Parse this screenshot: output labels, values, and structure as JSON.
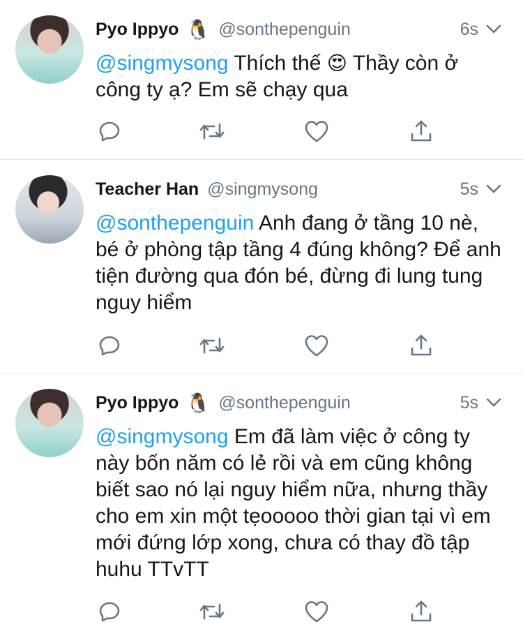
{
  "tweets": [
    {
      "display_name": "Pyo Ippyo",
      "badge_emoji": "🐧",
      "handle": "@sonthepenguin",
      "time": "6s",
      "mention": "@singmysong",
      "text_before_emoji": " Thích thế ",
      "emoji": "😍",
      "text_after_emoji": " Thầy còn ở công ty ạ? Em sẽ chạy qua"
    },
    {
      "display_name": "Teacher Han",
      "handle": "@singmysong",
      "time": "5s",
      "mention": "@sonthepenguin",
      "text": " Anh đang ở tầng 10 nè, bé ở phòng tập tầng 4 đúng không? Để anh tiện đường qua đón bé, đừng đi lung tung nguy hiểm"
    },
    {
      "display_name": "Pyo Ippyo",
      "badge_emoji": "🐧",
      "handle": "@sonthepenguin",
      "time": "5s",
      "mention": "@singmysong",
      "text": " Em đã làm việc ở công ty này bốn năm có lẻ rồi và em cũng không biết sao nó lại nguy hiểm nữa, nhưng thầy cho em xin một tẹooooo thời gian tại vì em mới đứng lớp xong, chưa có thay đồ tập huhu TTvTT"
    }
  ],
  "icons": {
    "reply": "reply-icon",
    "retweet": "retweet-icon",
    "like": "heart-icon",
    "share": "share-icon",
    "caret": "chevron-down-icon"
  },
  "colors": {
    "mention": "#1da1f2",
    "muted": "#657786",
    "text": "#14171a",
    "divider": "#e1e8ed"
  }
}
